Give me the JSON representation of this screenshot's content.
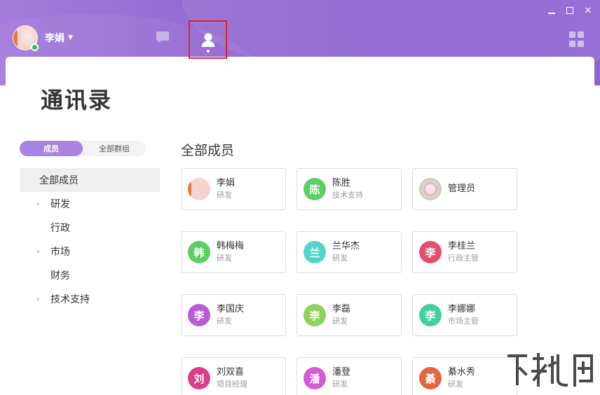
{
  "window": {
    "controls": [
      "minimize",
      "maximize",
      "close"
    ]
  },
  "user": {
    "name": "李娟",
    "status": "online"
  },
  "nav": {
    "chat_icon": "chat-bubble-icon",
    "contacts_icon": "person-icon",
    "apps_icon": "grid-apps-icon"
  },
  "page": {
    "title": "通讯录"
  },
  "tabs": {
    "members": "成员",
    "groups": "全部群组"
  },
  "tree": [
    {
      "label": "全部成员",
      "expandable": false,
      "selected": true
    },
    {
      "label": "研发",
      "expandable": true
    },
    {
      "label": "行政",
      "expandable": false
    },
    {
      "label": "市场",
      "expandable": true
    },
    {
      "label": "财务",
      "expandable": false
    },
    {
      "label": "技术支持",
      "expandable": true
    }
  ],
  "section": {
    "title": "全部成员"
  },
  "members": [
    {
      "name": "李娟",
      "role": "研发",
      "avatar_text": "",
      "color": "#f6d3cf",
      "photo": true
    },
    {
      "name": "陈胜",
      "role": "技术支持",
      "avatar_text": "陈",
      "color": "#5bcf61"
    },
    {
      "name": "管理员",
      "role": "",
      "avatar_text": "",
      "color": "#c9d4c0",
      "photo": true
    },
    {
      "name": "韩梅梅",
      "role": "研发",
      "avatar_text": "韩",
      "color": "#5bcf61"
    },
    {
      "name": "兰华杰",
      "role": "研发",
      "avatar_text": "兰",
      "color": "#4fd6c8"
    },
    {
      "name": "李桂兰",
      "role": "行政主管",
      "avatar_text": "李",
      "color": "#e0506e"
    },
    {
      "name": "李国庆",
      "role": "研发",
      "avatar_text": "李",
      "color": "#b85ad6"
    },
    {
      "name": "李磊",
      "role": "研发",
      "avatar_text": "李",
      "color": "#8fd15c"
    },
    {
      "name": "李娜娜",
      "role": "市场主管",
      "avatar_text": "李",
      "color": "#45cf9d"
    },
    {
      "name": "刘双喜",
      "role": "项目经理",
      "avatar_text": "刘",
      "color": "#d83e8c"
    },
    {
      "name": "潘登",
      "role": "研发",
      "avatar_text": "潘",
      "color": "#d65ad2"
    },
    {
      "name": "綦水秀",
      "role": "研发",
      "avatar_text": "綦",
      "color": "#e4643e"
    }
  ]
}
